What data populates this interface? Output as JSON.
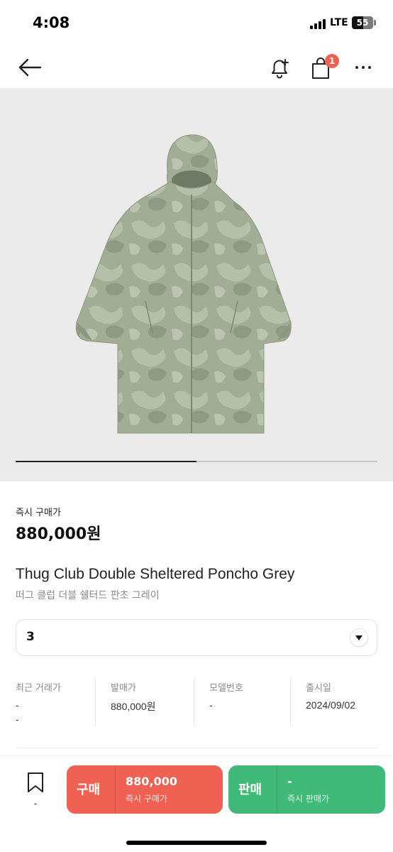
{
  "status_bar": {
    "time": "4:08",
    "network": "LTE",
    "battery": "55"
  },
  "header": {
    "back_icon": "arrow-left-icon",
    "bell_icon": "bell-plus-icon",
    "bag_icon": "shopping-bag-icon",
    "bag_badge": "1",
    "more_icon": "more-horizontal-icon"
  },
  "gallery": {
    "progress": 0.5
  },
  "product": {
    "price_label": "즉시 구매가",
    "price": "880,000원",
    "name_en": "Thug Club Double Sheltered Poncho Grey",
    "name_ko": "떠그 클럽 더블 쉘터드 판초 그레이"
  },
  "size_select": {
    "value": "3"
  },
  "stats": [
    {
      "label": "최근 거래가",
      "value": "-",
      "value2": "-"
    },
    {
      "label": "발매가",
      "value": "880,000원"
    },
    {
      "label": "모델번호",
      "value": "-"
    },
    {
      "label": "출시일",
      "value": "2024/09/02"
    }
  ],
  "bottom_bar": {
    "bookmark_count": "-",
    "buy": {
      "label": "구매",
      "price": "880,000",
      "sub": "즉시 구매가"
    },
    "sell": {
      "label": "판매",
      "price": "-",
      "sub": "즉시 판매가"
    }
  },
  "colors": {
    "buy": "#ef6253",
    "sell": "#41b979",
    "badge": "#ef6253",
    "image_bg": "#ebebeb"
  }
}
